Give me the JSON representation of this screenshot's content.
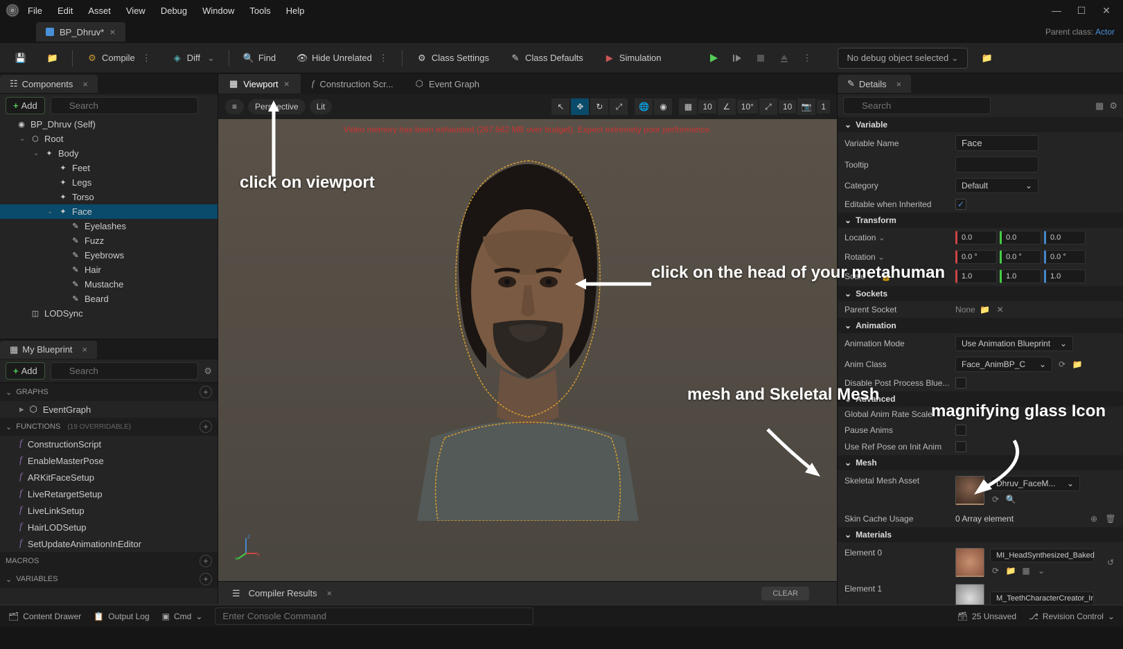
{
  "menu": [
    "File",
    "Edit",
    "Asset",
    "View",
    "Debug",
    "Window",
    "Tools",
    "Help"
  ],
  "tab": {
    "title": "BP_Dhruv*",
    "close": "×"
  },
  "parent": {
    "label": "Parent class:",
    "value": "Actor"
  },
  "toolbar": {
    "compile": "Compile",
    "diff": "Diff",
    "find": "Find",
    "hide": "Hide Unrelated",
    "classSettings": "Class Settings",
    "classDefaults": "Class Defaults",
    "simulation": "Simulation",
    "debugSelect": "No debug object selected"
  },
  "components": {
    "title": "Components",
    "add": "Add",
    "searchPlaceholder": "Search",
    "tree": [
      {
        "label": "BP_Dhruv (Self)",
        "indent": 0,
        "icon": "globe",
        "expandable": false
      },
      {
        "label": "Root",
        "indent": 1,
        "icon": "scene",
        "expandable": true
      },
      {
        "label": "Body",
        "indent": 2,
        "icon": "skel",
        "expandable": true
      },
      {
        "label": "Feet",
        "indent": 3,
        "icon": "skel"
      },
      {
        "label": "Legs",
        "indent": 3,
        "icon": "skel"
      },
      {
        "label": "Torso",
        "indent": 3,
        "icon": "skel"
      },
      {
        "label": "Face",
        "indent": 3,
        "icon": "skel",
        "expandable": true,
        "selected": true
      },
      {
        "label": "Eyelashes",
        "indent": 4,
        "icon": "groom"
      },
      {
        "label": "Fuzz",
        "indent": 4,
        "icon": "groom"
      },
      {
        "label": "Eyebrows",
        "indent": 4,
        "icon": "groom"
      },
      {
        "label": "Hair",
        "indent": 4,
        "icon": "groom"
      },
      {
        "label": "Mustache",
        "indent": 4,
        "icon": "groom"
      },
      {
        "label": "Beard",
        "indent": 4,
        "icon": "groom"
      },
      {
        "label": "LODSync",
        "indent": 1,
        "icon": "lod"
      }
    ]
  },
  "myblueprint": {
    "title": "My Blueprint",
    "add": "Add",
    "searchPlaceholder": "Search",
    "graphs": {
      "header": "GRAPHS",
      "items": [
        "EventGraph"
      ]
    },
    "functions": {
      "header": "FUNCTIONS",
      "suffix": "(19 OVERRIDABLE)",
      "items": [
        "ConstructionScript",
        "EnableMasterPose",
        "ARKitFaceSetup",
        "LiveRetargetSetup",
        "LiveLinkSetup",
        "HairLODSetup",
        "SetUpdateAnimationInEditor"
      ]
    },
    "macros": "MACROS",
    "variables": "VARIABLES"
  },
  "centerTabs": [
    {
      "label": "Viewport",
      "active": true,
      "closable": true,
      "icon": "grid"
    },
    {
      "label": "Construction Scr...",
      "icon": "func"
    },
    {
      "label": "Event Graph",
      "icon": "graph"
    }
  ],
  "vpToolbar": {
    "menu": "≡",
    "persp": "Perspective",
    "lit": "Lit",
    "grid": "10",
    "angle": "10°",
    "scale": "10",
    "cam": "1"
  },
  "perfWarning": "Video memory has been exhausted (267.562 MB over budget). Expect extremely poor performance.",
  "compiler": {
    "title": "Compiler Results",
    "clear": "CLEAR"
  },
  "details": {
    "title": "Details",
    "searchPlaceholder": "Search",
    "variable": {
      "header": "Variable",
      "name": {
        "label": "Variable Name",
        "value": "Face"
      },
      "tooltip": {
        "label": "Tooltip",
        "value": ""
      },
      "category": {
        "label": "Category",
        "value": "Default"
      },
      "editable": {
        "label": "Editable when Inherited",
        "checked": true
      }
    },
    "transform": {
      "header": "Transform",
      "location": {
        "label": "Location",
        "x": "0.0",
        "y": "0.0",
        "z": "0.0"
      },
      "rotation": {
        "label": "Rotation",
        "x": "0.0 °",
        "y": "0.0 °",
        "z": "0.0 °"
      },
      "scale": {
        "label": "Scale",
        "x": "1.0",
        "y": "1.0",
        "z": "1.0"
      }
    },
    "sockets": {
      "header": "Sockets",
      "parent": {
        "label": "Parent Socket",
        "value": "None"
      }
    },
    "animation": {
      "header": "Animation",
      "mode": {
        "label": "Animation Mode",
        "value": "Use Animation Blueprint"
      },
      "class": {
        "label": "Anim Class",
        "value": "Face_AnimBP_C"
      },
      "disable": {
        "label": "Disable Post Process Blue..."
      }
    },
    "advanced": {
      "header": "Advanced",
      "rate": {
        "label": "Global Anim Rate Scale"
      },
      "pause": {
        "label": "Pause Anims"
      },
      "refpose": {
        "label": "Use Ref Pose on Init Anim"
      }
    },
    "mesh": {
      "header": "Mesh",
      "asset": {
        "label": "Skeletal Mesh Asset",
        "value": "Dhruv_FaceM..."
      },
      "cache": {
        "label": "Skin Cache Usage",
        "value": "0 Array element"
      }
    },
    "materials": {
      "header": "Materials",
      "el0": {
        "label": "Element 0",
        "value": "MI_HeadSynthesized_Baked"
      },
      "el1": {
        "label": "Element 1",
        "value": "M_TeethCharacterCreator_Ir"
      }
    }
  },
  "statusbar": {
    "drawer": "Content Drawer",
    "output": "Output Log",
    "cmd": "Cmd",
    "cmdPlaceholder": "Enter Console Command",
    "unsaved": "25 Unsaved",
    "revision": "Revision Control"
  },
  "annotations": {
    "viewport": "click on viewport",
    "head": "click on the head of your metahuman",
    "mesh": "mesh and Skeletal Mesh",
    "magnify": "magnifying glass Icon"
  }
}
